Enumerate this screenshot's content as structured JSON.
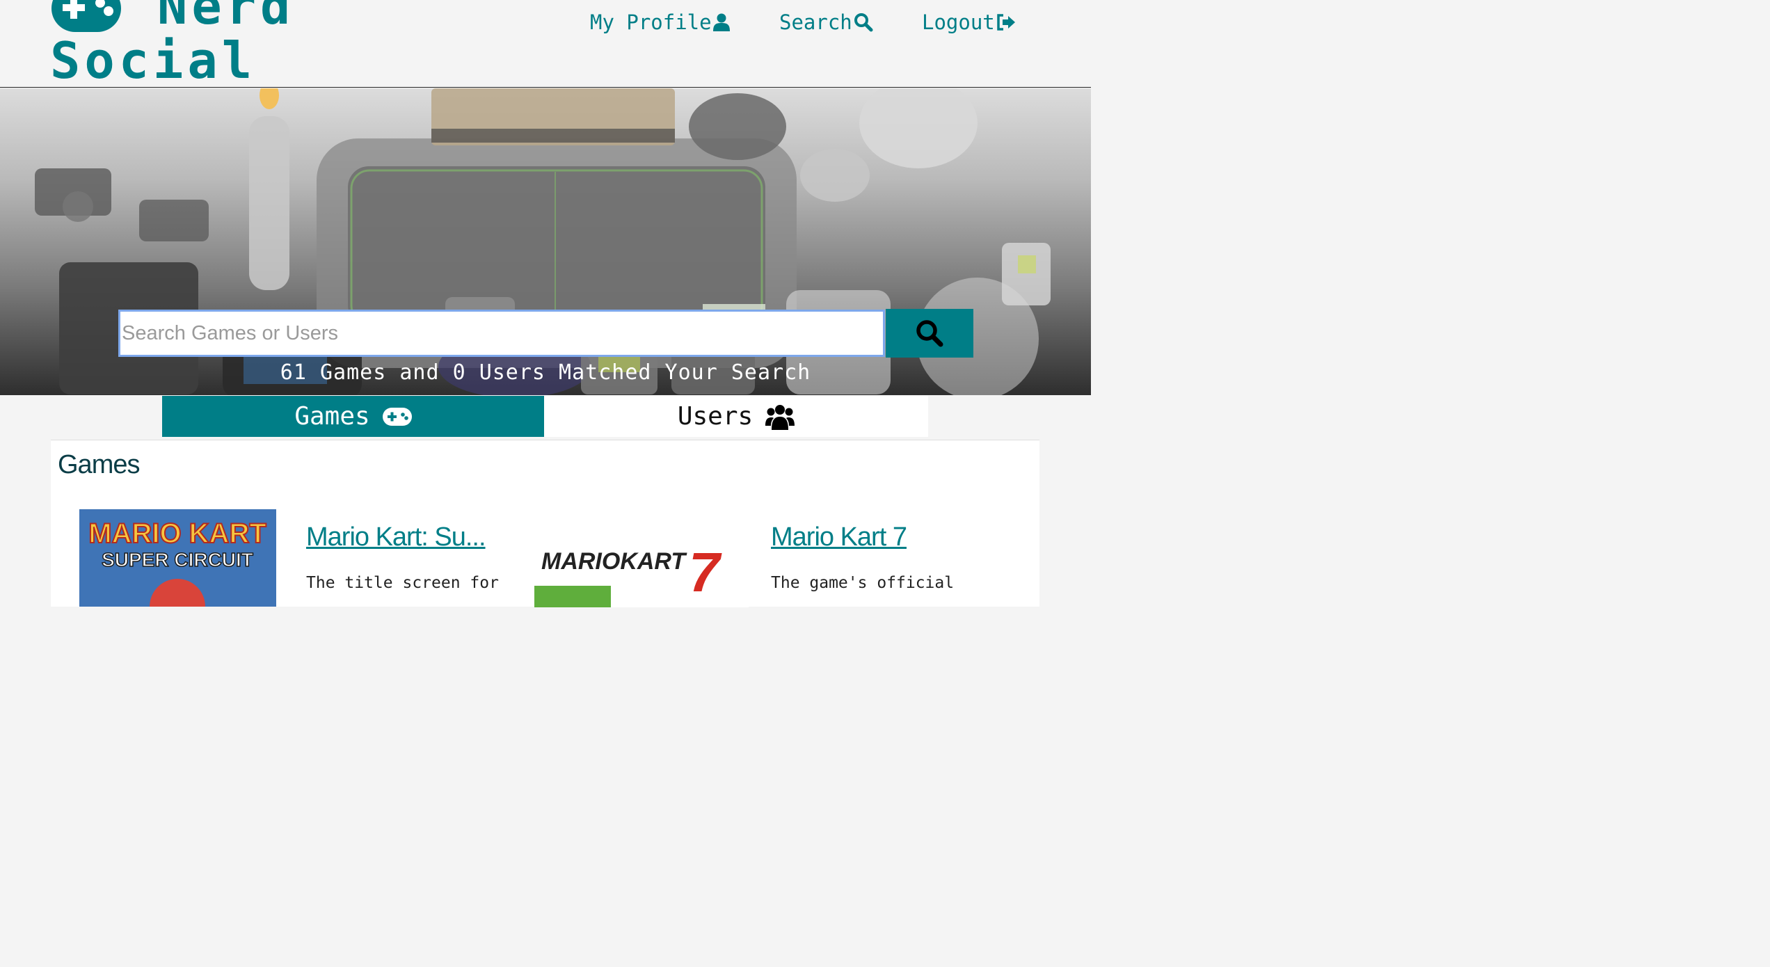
{
  "header": {
    "logo_line1": "Nerd",
    "logo_line2": "Social",
    "nav": [
      {
        "label": "My Profile",
        "icon": "user-icon"
      },
      {
        "label": "Search",
        "icon": "search-icon"
      },
      {
        "label": "Logout",
        "icon": "sign-out-icon"
      }
    ]
  },
  "hero": {
    "search_placeholder": "Search Games or Users",
    "search_value": "",
    "result_text": "61 Games and 0 Users Matched Your Search"
  },
  "tabs": {
    "games_label": "Games",
    "users_label": "Users",
    "active": "Games"
  },
  "content": {
    "section_title": "Games",
    "games": [
      {
        "title": "Mario Kart: Su...",
        "description": "The title screen for",
        "cover_line1": "MARIO KART",
        "cover_line2": "SUPER CIRCUIT"
      },
      {
        "title": "Mario Kart 7",
        "description": "The game's official",
        "cover_line1": "MARIOKART",
        "cover_line2": "7"
      }
    ]
  },
  "colors": {
    "accent": "#007e87",
    "page_bg": "#f4f4f4",
    "heading": "#0b3d47"
  }
}
